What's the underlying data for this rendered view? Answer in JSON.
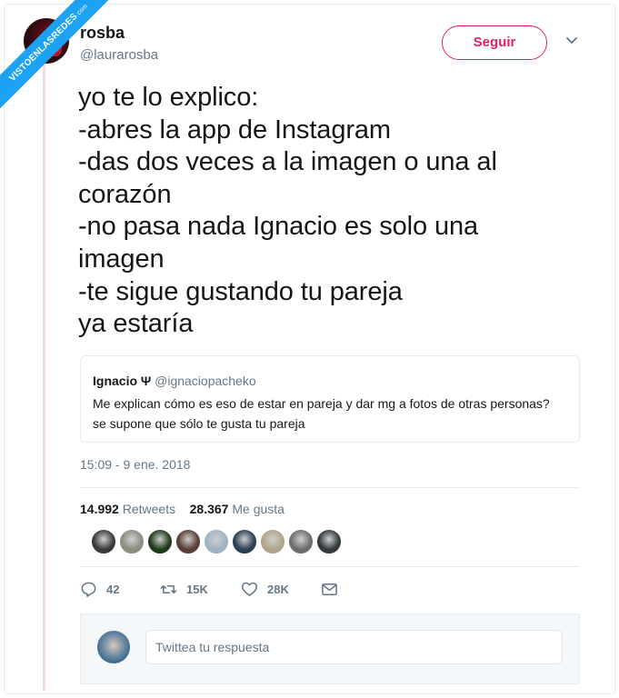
{
  "watermark": {
    "text": "VISTOENLASREDES",
    "suffix": ".com"
  },
  "author": {
    "name": "rosba",
    "handle": "@laurarosba"
  },
  "follow_label": "Seguir",
  "tweet_lines": [
    "yo te lo explico:",
    "-abres la app de Instagram",
    "-das dos veces a la imagen o una al",
    "corazón",
    "-no pasa nada Ignacio es solo una",
    "imagen",
    "-te sigue gustando tu pareja",
    "ya estaría"
  ],
  "quoted": {
    "name": "Ignacio Ψ",
    "handle": "@ignaciopacheko",
    "text": "Me explican cómo es eso de estar en pareja y dar mg a fotos de otras personas? se supone que sólo te gusta tu pareja"
  },
  "timestamp": "15:09 - 9 ene. 2018",
  "stats": {
    "retweets_count": "14.992",
    "retweets_label": "Retweets",
    "likes_count": "28.367",
    "likes_label": "Me gusta"
  },
  "liker_colors": [
    "#3a3a3a",
    "#8a8f80",
    "#1f3a1a",
    "#5a3d35",
    "#9fb3c4",
    "#2b3f55",
    "#b0a58a",
    "#6d6d6d",
    "#333a3d"
  ],
  "actions": {
    "replies": "42",
    "retweets": "15K",
    "likes": "28K"
  },
  "reply_placeholder": "Twittea tu respuesta",
  "colors": {
    "accent_pink": "#e0245e",
    "muted_gray": "#657786",
    "twitter_blue": "#1da1f2"
  }
}
